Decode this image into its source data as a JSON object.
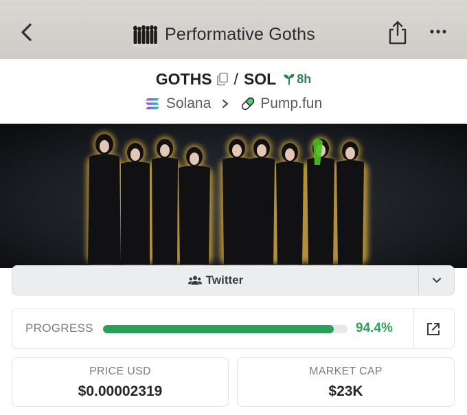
{
  "header": {
    "title": "Performative Goths",
    "icons": [
      "back-arrow-icon",
      "share-icon",
      "more-icon"
    ]
  },
  "pair": {
    "base_symbol": "GOTHS",
    "separator": "/",
    "quote_symbol": "SOL",
    "age": "8h"
  },
  "chain": {
    "network": "Solana",
    "dex": "Pump.fun"
  },
  "social": {
    "twitter_label": "Twitter"
  },
  "progress": {
    "label": "PROGRESS",
    "value_text": "94.4%",
    "value": 0.944,
    "color": "#2e9e5b"
  },
  "stats": {
    "price_label": "PRICE USD",
    "price_value": "$0.00002319",
    "mcap_label": "MARKET CAP",
    "mcap_value": "$23K"
  }
}
